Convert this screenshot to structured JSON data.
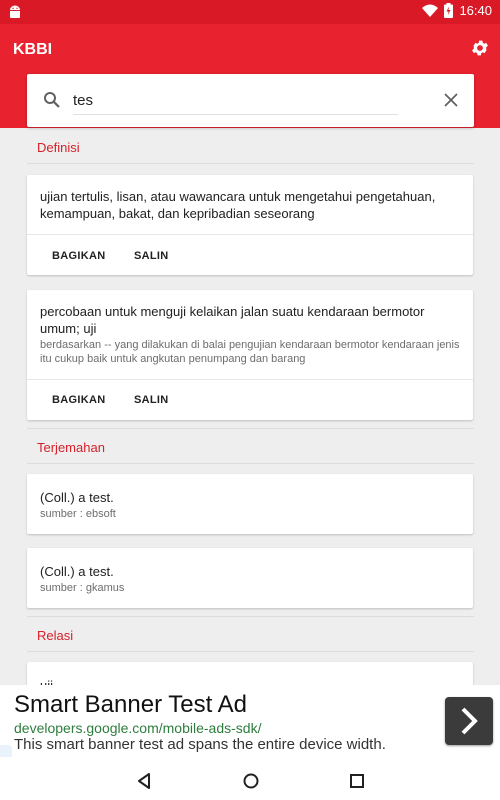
{
  "status_bar": {
    "time": "16:40"
  },
  "app_bar": {
    "title": "KBBI",
    "settings_icon": "gear-icon"
  },
  "search": {
    "value": "tes",
    "placeholder": ""
  },
  "sections": {
    "definisi": "Definisi",
    "terjemahan": "Terjemahan",
    "relasi": "Relasi"
  },
  "definitions": [
    {
      "text": "ujian tertulis, lisan, atau wawancara untuk mengetahui pengetahuan, kemampuan, bakat, dan kepribadian seseorang",
      "share_label": "BAGIKAN",
      "copy_label": "SALIN"
    },
    {
      "text": "percobaan untuk menguji kelaikan jalan suatu kendaraan bermotor umum; uji",
      "example": "berdasarkan -- yang dilakukan di balai pengujian kendaraan bermotor kendaraan jenis itu cukup baik untuk angkutan penumpang dan barang",
      "share_label": "BAGIKAN",
      "copy_label": "SALIN"
    }
  ],
  "translations": [
    {
      "text": "(Coll.) a test.",
      "source": "sumber : ebsoft"
    },
    {
      "text": "(Coll.) a test.",
      "source": "sumber : gkamus"
    }
  ],
  "relations": [
    {
      "text": "uji"
    }
  ],
  "ad": {
    "title": "Smart Banner Test Ad",
    "url": "developers.google.com/mobile-ads-sdk/",
    "description": "This smart banner test ad spans the entire device width."
  },
  "colors": {
    "primary": "#e8232f",
    "primary_dark": "#d91a26",
    "accent": "#d6202a"
  }
}
